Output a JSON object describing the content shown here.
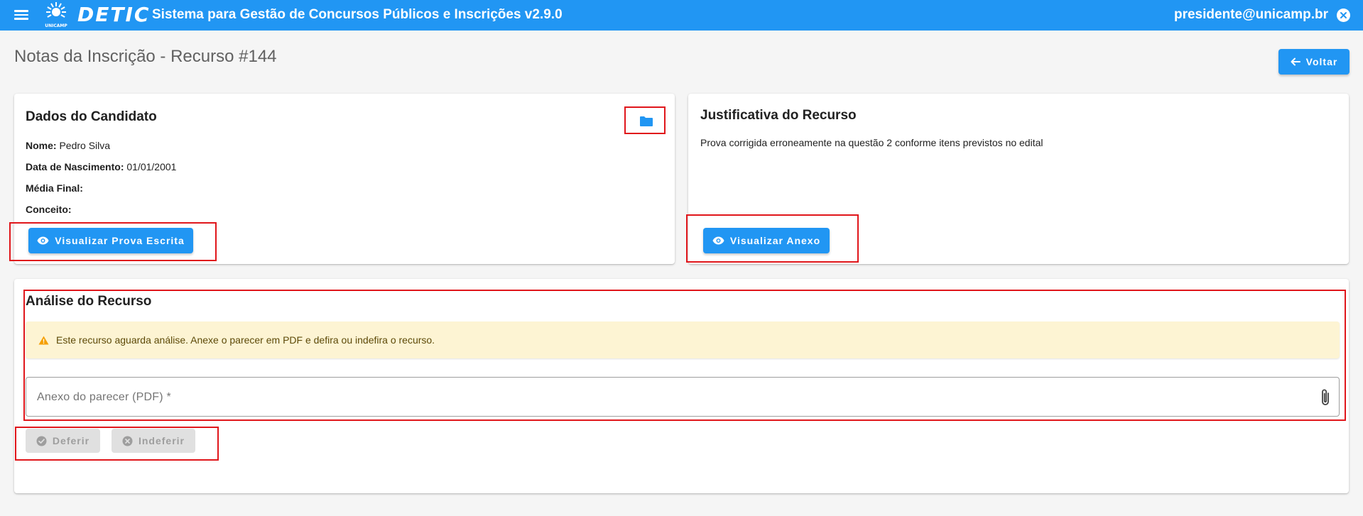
{
  "header": {
    "brand": "DETIC",
    "logo_caption": "UNICAMP",
    "title": "Sistema para Gestão de Concursos Públicos e Inscrições v2.9.0",
    "user_email": "presidente@unicamp.br",
    "accent_color": "#2196f3"
  },
  "page": {
    "title": "Notas da Inscrição - Recurso #144",
    "back_label": "Voltar"
  },
  "candidate": {
    "title": "Dados do Candidato",
    "fields": [
      {
        "label": "Nome:",
        "value": "Pedro Silva"
      },
      {
        "label": "Data de Nascimento:",
        "value": "01/01/2001"
      },
      {
        "label": "Média Final:",
        "value": ""
      },
      {
        "label": "Conceito:",
        "value": ""
      }
    ],
    "view_exam_label": "Visualizar Prova Escrita",
    "folder_icon": "folder-icon"
  },
  "justification": {
    "title": "Justificativa do Recurso",
    "text": "Prova corrigida erroneamente na questão 2 conforme itens previstos no edital",
    "view_attachment_label": "Visualizar Anexo"
  },
  "analysis": {
    "title": "Análise do Recurso",
    "alert_text": "Este recurso aguarda análise. Anexe o parecer em PDF e defira ou indefira o recurso.",
    "file_placeholder": "Anexo do parecer (PDF) *",
    "approve_label": "Deferir",
    "reject_label": "Indeferir"
  },
  "colors": {
    "primary": "#2196f3",
    "warning_bg": "#fdf4d3",
    "highlight": "#e0161b",
    "disabled_bg": "#e0e0e0"
  }
}
